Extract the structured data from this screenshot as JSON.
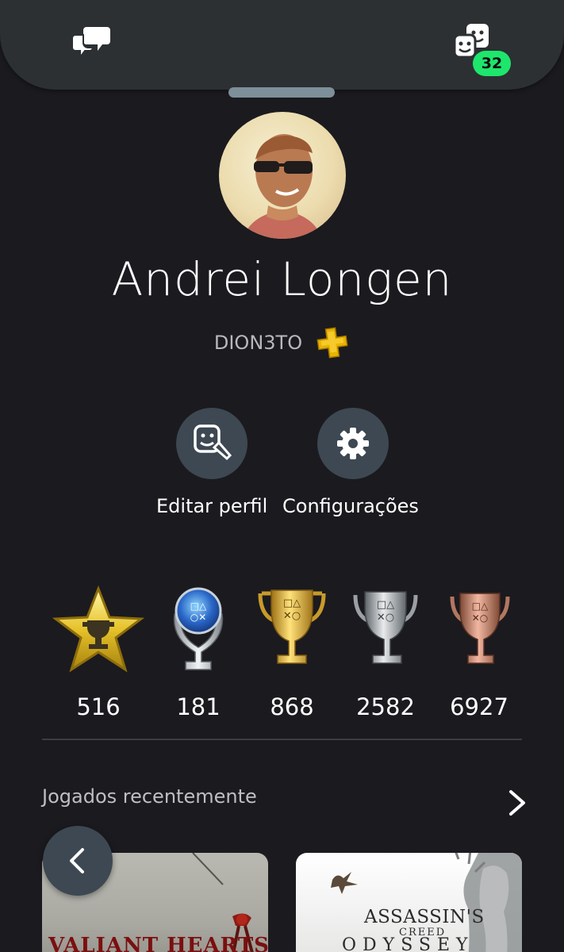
{
  "header": {
    "chat_icon": "chat-bubbles-icon",
    "friends_icon": "friends-faces-icon",
    "friends_badge_count": "32",
    "badge_color": "#1ee66c"
  },
  "profile": {
    "avatar": "profile-photo",
    "display_name": "Andrei Longen",
    "online_id": "DION3TO",
    "plus_icon": "ps-plus-icon"
  },
  "actions": {
    "edit_profile_label": "Editar perfil",
    "settings_label": "Configurações"
  },
  "trophies": [
    {
      "icon": "level-star-trophy-icon",
      "count": "516"
    },
    {
      "icon": "platinum-trophy-icon",
      "count": "181"
    },
    {
      "icon": "gold-trophy-icon",
      "count": "868"
    },
    {
      "icon": "silver-trophy-icon",
      "count": "2582"
    },
    {
      "icon": "bronze-trophy-icon",
      "count": "6927"
    }
  ],
  "recent": {
    "label": "Jogados recentemente",
    "games": [
      {
        "title_art": "VALIANT HEARTS"
      },
      {
        "title_art_line1": "ASSASSIN'S",
        "title_art_line2": "CREED",
        "title_art_line3": "ODYSSEY"
      }
    ]
  },
  "colors": {
    "background": "#1b1a1f",
    "header_bg": "#2c3033",
    "button_bg": "#3d4852"
  }
}
